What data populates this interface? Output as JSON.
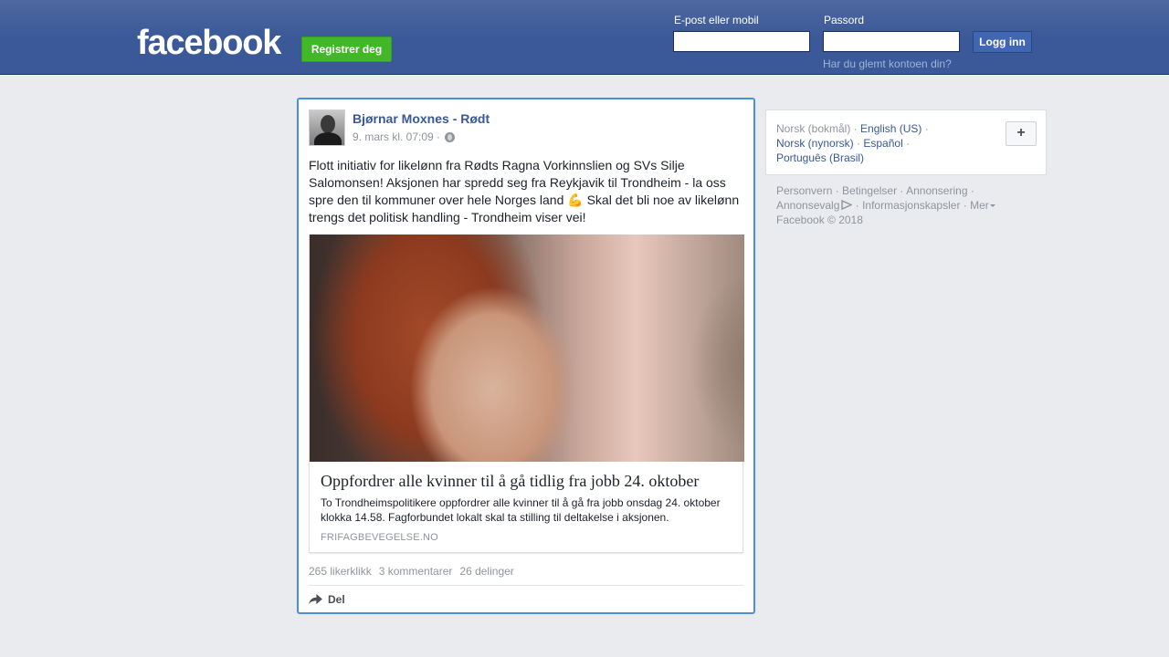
{
  "header": {
    "logo_text": "facebook",
    "register_label": "Registrer deg",
    "email_label": "E-post eller mobil",
    "email_value": "",
    "password_label": "Passord",
    "password_value": "",
    "login_label": "Logg inn",
    "forgot_link": "Har du glemt kontoen din?",
    "colors": {
      "bar": "#3b5998",
      "register": "#42b72a"
    }
  },
  "post": {
    "author": "Bjørnar Moxnes - Rødt",
    "timestamp": "9. mars kl. 07:09 ·",
    "text_before_emoji": "Flott initiativ for likelønn fra Rødts Ragna Vorkinnslien og SVs Silje Salomonsen! Aksjonen har spredd seg fra Reykjavik til Trondheim - la oss spre den til kommuner over hele Norges land",
    "emoji": "💪",
    "text_after_emoji": " Skal det bli noe av likelønn trengs det politisk handling - Trondheim viser vei!",
    "link": {
      "title": "Oppfordrer alle kvinner til å gå tidlig fra jobb 24. oktober",
      "description": "To Trondheimspolitikere oppfordrer alle kvinner til å gå fra jobb onsdag 24. oktober klokka 14.58. Fagforbundet lokalt skal ta stilling til deltakelse i aksjonen.",
      "domain": "FRIFAGBEVEGELSE.NO"
    },
    "stats": {
      "likes": "265 likerklikk",
      "comments": "3 kommentarer",
      "shares": "26 delinger"
    },
    "share_label": "Del"
  },
  "sidebar": {
    "languages": {
      "current": "Norsk (bokmål)",
      "links": [
        "English (US)",
        "Norsk (nynorsk)",
        "Español",
        "Português (Brasil)"
      ],
      "add_label": "+"
    },
    "footer": {
      "links": [
        "Personvern",
        "Betingelser",
        "Annonsering",
        "Annonsevalg",
        "Informasjonskapsler",
        "Mer"
      ],
      "copyright": "Facebook © 2018"
    }
  }
}
